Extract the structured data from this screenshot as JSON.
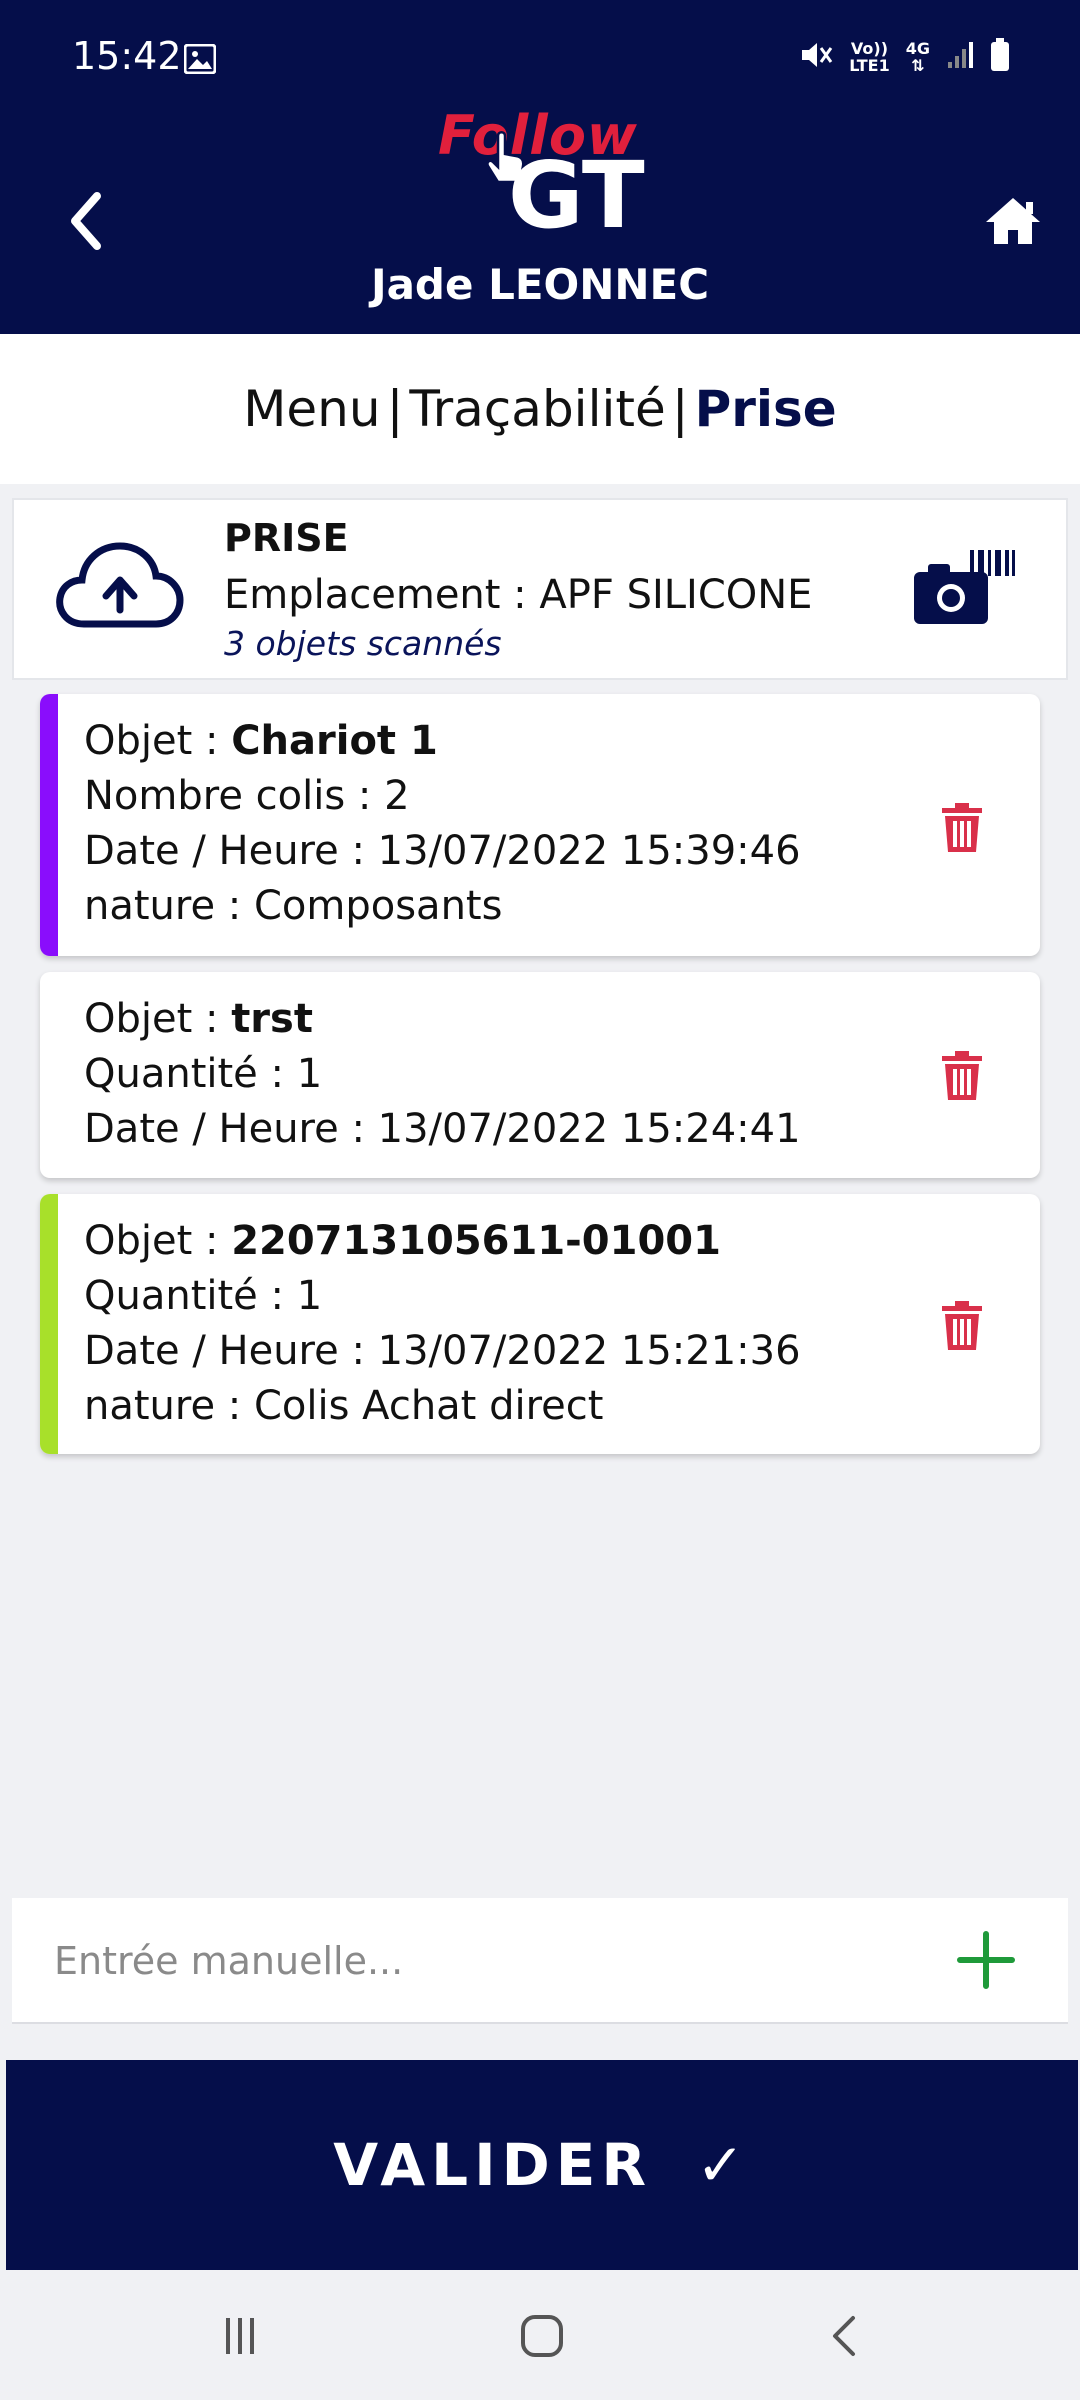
{
  "status_bar": {
    "time": "15:42",
    "icons": [
      "gallery-icon",
      "mute-icon",
      "volte-icon",
      "4g-icon",
      "signal-icon",
      "battery-icon"
    ],
    "volte_label_top": "Vo))",
    "volte_label_bottom": "LTE1",
    "network_label": "4G"
  },
  "header": {
    "logo_follow": "Follow",
    "logo_gt": "GT",
    "user_name": "Jade LEONNEC",
    "back_icon": "chevron-left-icon",
    "home_icon": "home-icon"
  },
  "breadcrumb": {
    "items": [
      "Menu",
      "Traçabilité",
      "Prise"
    ],
    "separator": "|"
  },
  "info": {
    "title": "PRISE",
    "location": "Emplacement : APF SILICONE",
    "scan_count": "3 objets scannés",
    "icons": [
      "cloud-upload-icon",
      "camera-barcode-icon"
    ]
  },
  "items": [
    {
      "label_prefix": "Objet : ",
      "name": "Chariot 1",
      "line2": "Nombre colis : 2",
      "line3": "Date / Heure : 13/07/2022 15:39:46",
      "line4": "nature : Composants",
      "accent": "#8a0dfc"
    },
    {
      "label_prefix": "Objet : ",
      "name": "trst",
      "line2": "Quantité : 1",
      "line3": "Date / Heure : 13/07/2022 15:24:41",
      "line4": "",
      "accent": "#ffffff"
    },
    {
      "label_prefix": "Objet : ",
      "name": "220713105611-01001",
      "line2": "Quantité : 1",
      "line3": "Date / Heure : 13/07/2022 15:21:36",
      "line4": "nature : Colis Achat direct",
      "accent": "#a8e02a"
    }
  ],
  "manual_entry": {
    "placeholder": "Entrée manuelle..."
  },
  "validate": {
    "label": "VALIDER",
    "check": "✓"
  },
  "colors": {
    "primary": "#050e4a",
    "brand_red": "#e1203c",
    "trash": "#d9304a",
    "add": "#1f9a3a"
  },
  "nav_bar": {
    "icons": [
      "recent-apps-icon",
      "home-circle-icon",
      "back-chevron-icon"
    ]
  }
}
